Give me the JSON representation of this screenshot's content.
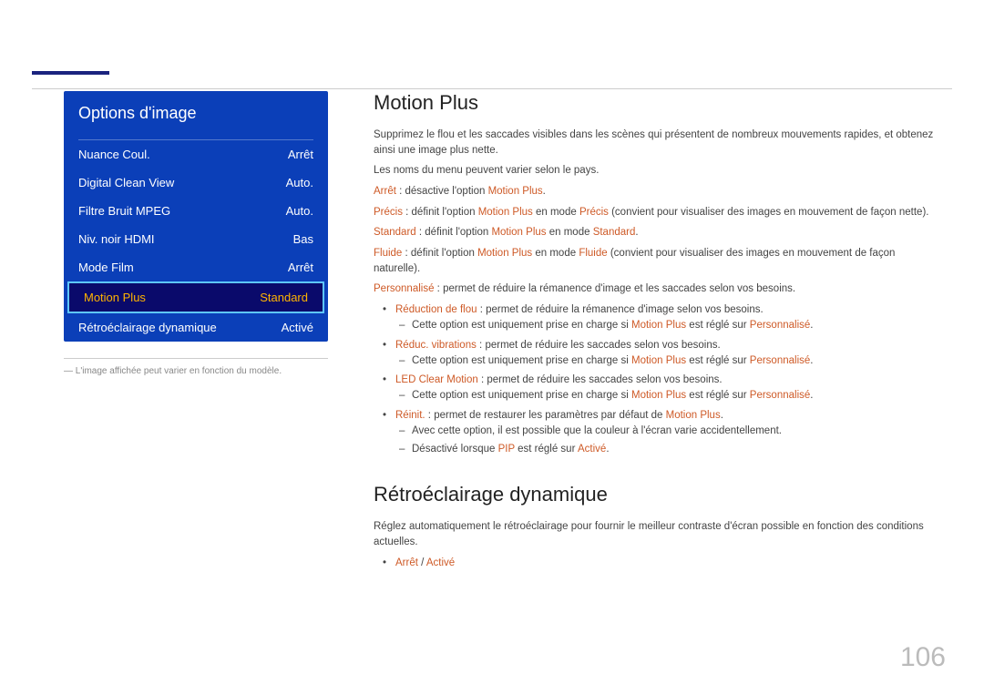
{
  "page_number": "106",
  "menu": {
    "title": "Options d'image",
    "items": [
      {
        "label": "Nuance Coul.",
        "value": "Arrêt"
      },
      {
        "label": "Digital Clean View",
        "value": "Auto."
      },
      {
        "label": "Filtre Bruit MPEG",
        "value": "Auto."
      },
      {
        "label": "Niv. noir HDMI",
        "value": "Bas"
      },
      {
        "label": "Mode Film",
        "value": "Arrêt"
      },
      {
        "label": "Motion Plus",
        "value": "Standard"
      },
      {
        "label": "Rétroéclairage dynamique",
        "value": "Activé"
      }
    ],
    "selected_index": 5,
    "note": "― L'image affichée peut varier en fonction du modèle."
  },
  "s1": {
    "title": "Motion Plus",
    "p1": "Supprimez le flou et les saccades visibles dans les scènes qui présentent de nombreux mouvements rapides, et obtenez ainsi une image plus nette.",
    "p2": "Les noms du menu peuvent varier selon le pays.",
    "arret_k": "Arrêt",
    "arret_t": " : désactive l'option ",
    "mp": "Motion Plus",
    "dot": ".",
    "precis_k": "Précis",
    "precis_t1": " : définit l'option ",
    "precis_t2": " en mode ",
    "precis_v": "Précis",
    "precis_t3": " (convient pour visualiser des images en mouvement de façon nette).",
    "standard_k": "Standard",
    "standard_t1": " : définit l'option ",
    "standard_t2": " en mode ",
    "standard_v": "Standard",
    "fluide_k": "Fluide",
    "fluide_t1": " : définit l'option ",
    "fluide_t2": " en mode ",
    "fluide_v": "Fluide",
    "fluide_t3": " (convient pour visualiser des images en mouvement de façon naturelle).",
    "perso_k": "Personnalisé",
    "perso_t": " : permet de réduire la rémanence d'image et les saccades selon vos besoins.",
    "rf_k": "Réduction de flou",
    "rf_t": " : permet de réduire la rémanence d'image selon vos besoins.",
    "rv_k": "Réduc. vibrations",
    "rv_t": " : permet de réduire les saccades selon vos besoins.",
    "lcm_k": "LED Clear Motion",
    "lcm_t": " : permet de réduire les saccades selon vos besoins.",
    "only_t1": "Cette option est uniquement prise en charge si ",
    "only_t2": " est réglé sur ",
    "only_v": "Personnalisé",
    "reinit_k": "Réinit.",
    "reinit_t": " : permet de restaurer les paramètres par défaut de ",
    "reinit_d1": "Avec cette option, il est possible que la couleur à l'écran varie accidentellement.",
    "reinit_d2a": "Désactivé lorsque ",
    "reinit_pip": "PIP",
    "reinit_d2b": " est réglé sur ",
    "reinit_active": "Activé"
  },
  "s2": {
    "title": "Rétroéclairage dynamique",
    "p1": "Réglez automatiquement le rétroéclairage pour fournir le meilleur contraste d'écran possible en fonction des conditions actuelles.",
    "o1": "Arrêt",
    "sep": " / ",
    "o2": "Activé"
  }
}
